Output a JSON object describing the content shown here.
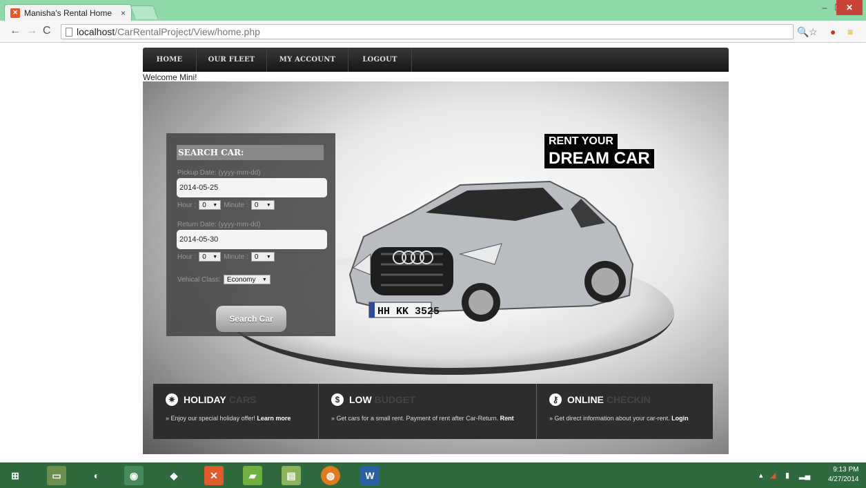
{
  "browser": {
    "tab_title": "Manisha's Rental Home",
    "tab_close": "×",
    "url_host": "localhost",
    "url_path": "/CarRentalProject/View/home.php"
  },
  "nav": {
    "items": [
      "HOME",
      "OUR FLEET",
      "MY ACCOUNT",
      "LOGOUT"
    ]
  },
  "welcome": "Welcome Mini!",
  "tagline": {
    "line1": "RENT YOUR",
    "line2": "DREAM CAR"
  },
  "search": {
    "heading": "SEARCH CAR:",
    "pickup_label": "Pickup Date: (yyyy-mm-dd)",
    "pickup_value": "2014-05-25",
    "return_label": "Return Date: (yyyy-mm-dd)",
    "return_value": "2014-05-30",
    "hour_label": "Hour :",
    "minute_label": "Minute :",
    "pickup_hour": "0",
    "pickup_minute": "0",
    "return_hour": "0",
    "return_minute": "0",
    "class_label": "Vehical Class:",
    "class_value": "Economy",
    "button": "Search Car"
  },
  "car_plate": "HH KK 3525",
  "features": [
    {
      "icon": "✷",
      "title": "HOLIDAY",
      "title_dim": "CARS",
      "desc": "» Enjoy our special holiday offer! ",
      "link": "Learn more"
    },
    {
      "icon": "$",
      "title": "LOW",
      "title_dim": "BUDGET",
      "desc": "» Get cars for a small rent. Payment of rent after Car-Return. ",
      "link": "Rent"
    },
    {
      "icon": "⚷",
      "title": "ONLINE",
      "title_dim": "CHECKIN",
      "desc": "» Get direct information about your car-rent. ",
      "link": "Login"
    }
  ],
  "clock": {
    "time": "9:13 PM",
    "date": "4/27/2014"
  },
  "colors": {
    "tab_strip": "#8fd9a8",
    "taskbar": "#2f6a3f",
    "menubar": "#1f1f1f"
  }
}
